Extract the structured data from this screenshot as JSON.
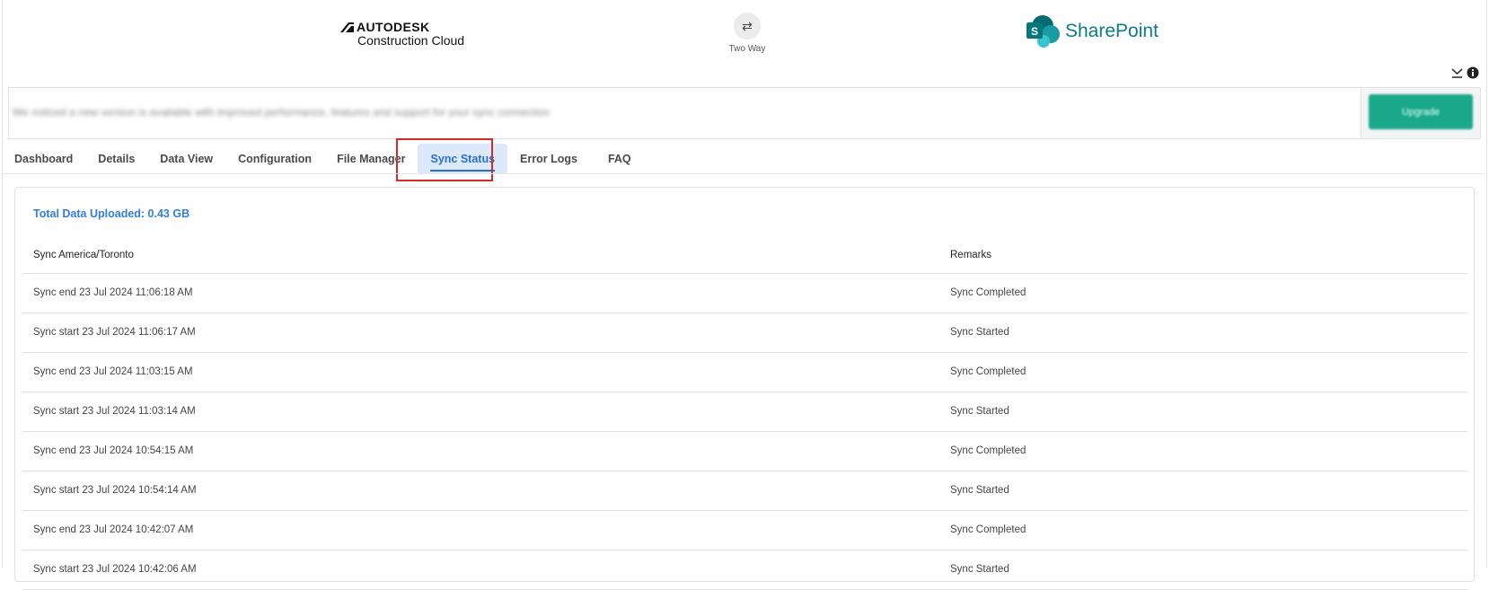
{
  "header": {
    "left_brand": {
      "line1": "AUTODESK",
      "line2": "Construction Cloud"
    },
    "sync_direction": {
      "icon": "swap-arrows-icon",
      "label": "Two Way"
    },
    "right_brand": {
      "name": "SharePoint"
    },
    "icons": [
      "collapse-icon",
      "info-icon"
    ]
  },
  "banner": {
    "message": "We noticed a new version is available with improved performance, features and support for your sync connection",
    "button_label": "Upgrade"
  },
  "tabs": [
    "Dashboard",
    "Details",
    "Data View",
    "Configuration",
    "File Manager",
    "Sync Status",
    "Error Logs",
    "FAQ"
  ],
  "active_tab": "Sync Status",
  "colors": {
    "accent": "#2f7ee0",
    "highlight_border": "#d42a2a",
    "sharepoint": "#0b7c86",
    "button": "#19a88a"
  },
  "panel": {
    "total_uploaded": "Total Data Uploaded: 0.43 GB",
    "columns": [
      "Sync America/Toronto",
      "Remarks"
    ],
    "rows": [
      {
        "time": "Sync end 23 Jul 2024 11:06:18 AM",
        "remark": "Sync Completed"
      },
      {
        "time": "Sync start 23 Jul 2024 11:06:17 AM",
        "remark": "Sync Started"
      },
      {
        "time": "Sync end 23 Jul 2024 11:03:15 AM",
        "remark": "Sync Completed"
      },
      {
        "time": "Sync start 23 Jul 2024 11:03:14 AM",
        "remark": "Sync Started"
      },
      {
        "time": "Sync end 23 Jul 2024 10:54:15 AM",
        "remark": "Sync Completed"
      },
      {
        "time": "Sync start 23 Jul 2024 10:54:14 AM",
        "remark": "Sync Started"
      },
      {
        "time": "Sync end 23 Jul 2024 10:42:07 AM",
        "remark": "Sync Completed"
      },
      {
        "time": "Sync start 23 Jul 2024 10:42:06 AM",
        "remark": "Sync Started"
      }
    ]
  }
}
